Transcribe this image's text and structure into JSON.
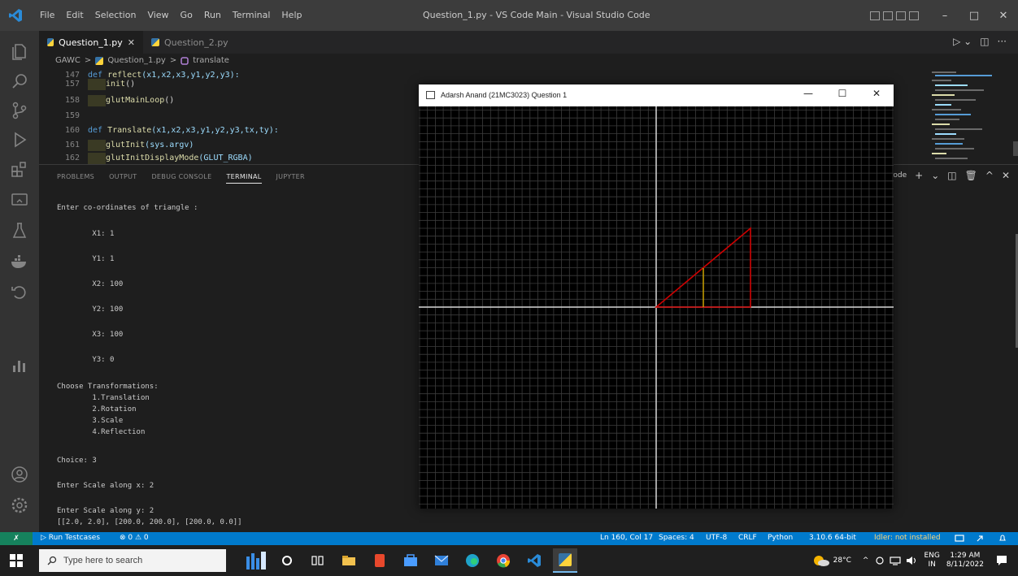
{
  "titlebar": {
    "menu": [
      "File",
      "Edit",
      "Selection",
      "View",
      "Go",
      "Run",
      "Terminal",
      "Help"
    ],
    "window_title": "Question_1.py - VS Code Main - Visual Studio Code",
    "controls": {
      "minimize": "–",
      "maximize": "□",
      "close": "✕"
    }
  },
  "tabs": [
    {
      "label": "Question_1.py",
      "close": "✕"
    },
    {
      "label": "Question_2.py"
    }
  ],
  "breadcrumb": {
    "folder": "GAWC",
    "file": "Question_1.py",
    "symbol": "translate",
    "separator": ">"
  },
  "editor_actions": {
    "run": "▷ ⌄",
    "split": "◫",
    "more": "···"
  },
  "code": [
    {
      "num": "147",
      "kw": "def ",
      "fn": "reflect",
      "rest": "(x1,x2,x3,y1,y2,y3):",
      "indent": false
    },
    {
      "num": "157",
      "kw": "",
      "fn": "init",
      "rest": "()",
      "indent": true
    },
    {
      "num": "158",
      "kw": "",
      "fn": "glutMainLoop",
      "rest": "()",
      "indent": true
    },
    {
      "num": "159",
      "kw": "",
      "fn": "",
      "rest": "",
      "indent": false
    },
    {
      "num": "160",
      "kw": "def ",
      "fn": "Translate",
      "rest": "(x1,x2,x3,y1,y2,y3,tx,ty):",
      "indent": false
    },
    {
      "num": "161",
      "kw": "",
      "fn": "glutInit",
      "rest": "(sys.argv)",
      "indent": true
    },
    {
      "num": "162",
      "kw": "",
      "fn": "glutInitDisplayMode",
      "rest": "(GLUT_RGBA)",
      "indent": true
    }
  ],
  "panel": {
    "tabs": [
      "PROBLEMS",
      "OUTPUT",
      "DEBUG CONSOLE",
      "TERMINAL",
      "JUPYTER"
    ],
    "active_tab": "TERMINAL",
    "right_label": "Code",
    "right_icons": {
      "add": "+",
      "dropdown": "⌄",
      "split": "◫",
      "trash": "🗑",
      "maximize": "^",
      "close": "✕"
    }
  },
  "terminal_lines": [
    "Enter co-ordinates of triangle :",
    "        X1: 1",
    "        Y1: 1",
    "        X2: 100",
    "        Y2: 100",
    "        X3: 100",
    "        Y3: 0",
    "Choose Transformations:",
    "        1.Translation",
    "        2.Rotation",
    "        3.Scale",
    "        4.Reflection",
    "Choice: 3",
    "Enter Scale along x: 2",
    "Enter Scale along y: 2",
    "[[2.0, 2.0], [200.0, 200.0], [200.0, 0.0]]"
  ],
  "glwindow": {
    "title": "Adarsh Anand (21MC3023) Question 1",
    "controls": {
      "minimize": "—",
      "maximize": "☐",
      "close": "✕"
    },
    "colors": {
      "grid": "#3c3c3c",
      "axis": "#d8d8d8",
      "triangle": "#cc0000",
      "altitude": "#c8a000"
    }
  },
  "statusbar": {
    "remote": "✗",
    "run_testcases": "▷ Run Testcases",
    "problems": "⊗ 0 ⚠ 0",
    "position": "Ln 160, Col 17",
    "spaces": "Spaces: 4",
    "encoding": "UTF-8",
    "eol": "CRLF",
    "language": "Python",
    "interpreter": "3.10.6 64-bit",
    "warning": "Idler: not installed"
  },
  "taskbar": {
    "search_placeholder": "Type here to search",
    "weather": "28°C",
    "language": "ENG",
    "region": "IN",
    "time": "1:29 AM",
    "date": "8/11/2022"
  }
}
